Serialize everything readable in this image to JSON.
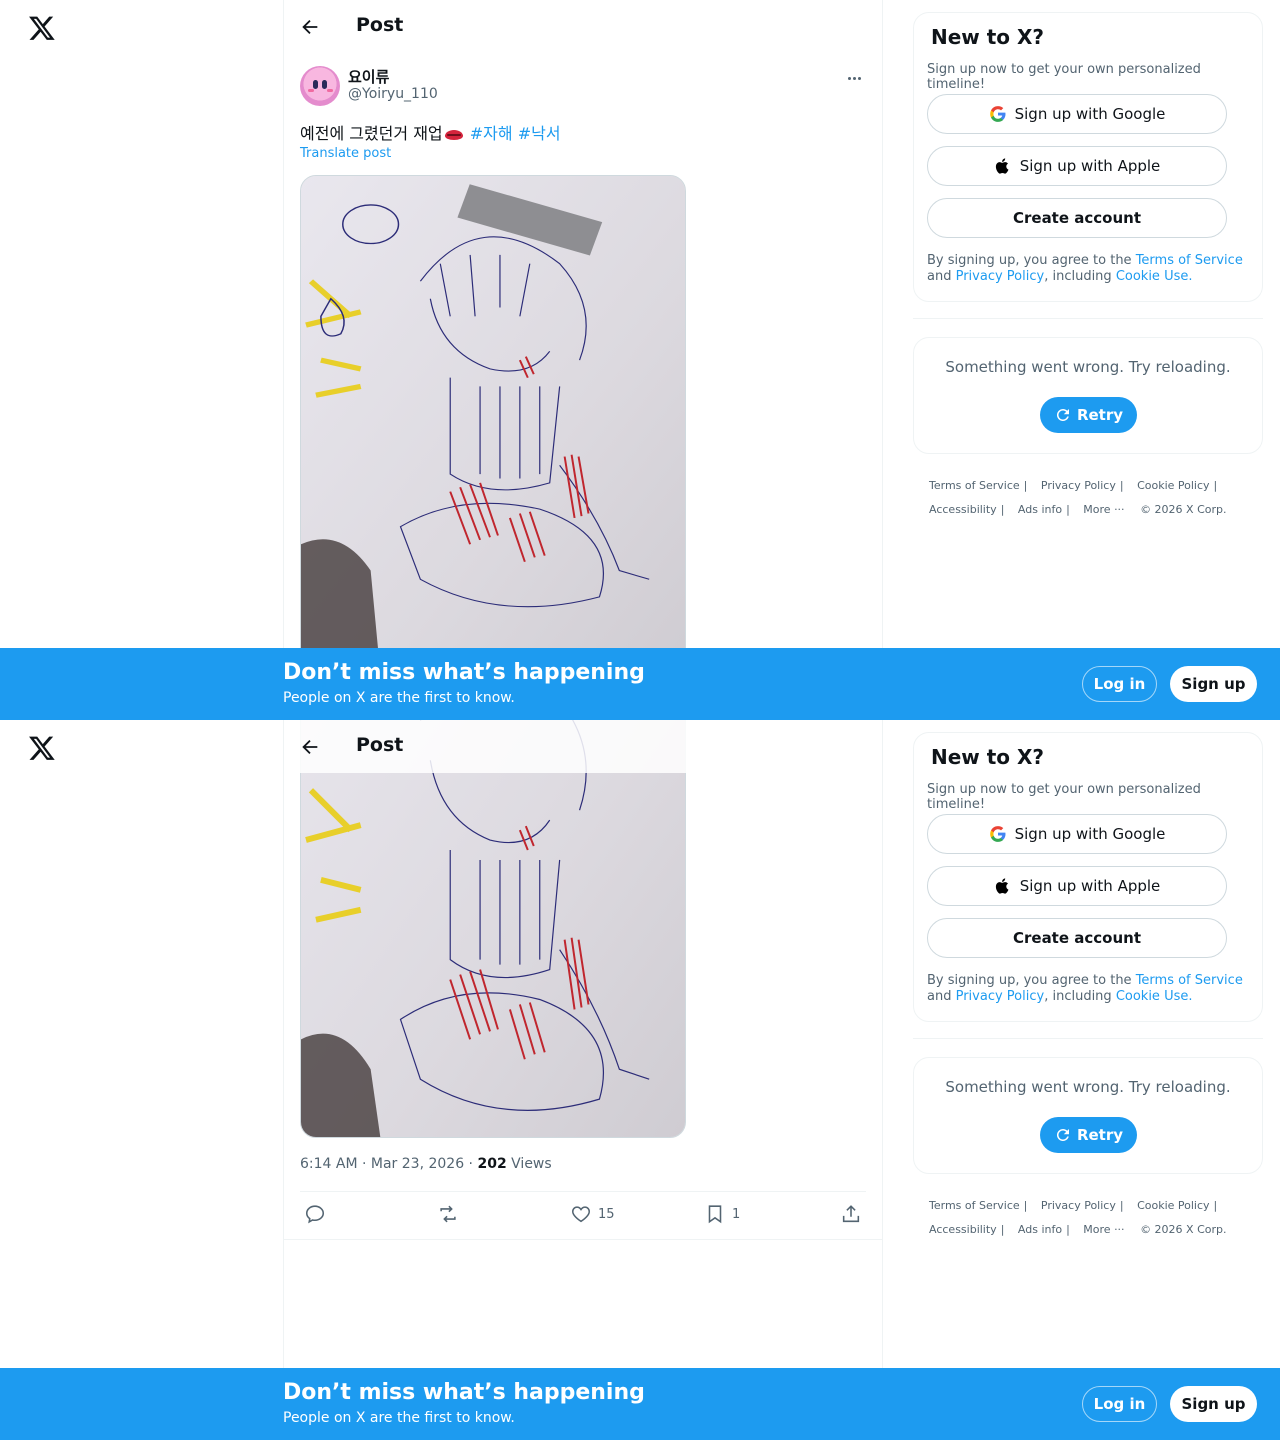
{
  "header": {
    "title": "Post"
  },
  "post": {
    "author_name": "요이류",
    "author_handle": "@Yoiryu_110",
    "text_main": "예전에 그렸던거 재업",
    "emoji_icon": "lips-emoji",
    "hashtags": [
      "#자해",
      "#낙서"
    ],
    "translate": "Translate post",
    "time": "6:14 AM · Mar 23, 2026 · ",
    "views_count": "202",
    "views_label": " Views",
    "image_description_icon": "sketch-image"
  },
  "actions": {
    "reply_count": "",
    "repost_count": "",
    "like_count": "15",
    "bookmark_count": "1"
  },
  "signup": {
    "title": "New to X?",
    "subtitle": "Sign up now to get your own personalized timeline!",
    "google": "Sign up with Google",
    "apple": "Sign up with Apple",
    "create": "Create account",
    "legal_prefix": "By signing up, you agree to the ",
    "terms": "Terms of Service",
    "and": " and ",
    "privacy": "Privacy Policy",
    "including": ", including ",
    "cookie": "Cookie Use."
  },
  "error": {
    "message": "Something went wrong. Try reloading.",
    "retry": "Retry"
  },
  "footer": {
    "links": [
      "Terms of Service",
      "Privacy Policy",
      "Cookie Policy",
      "Accessibility",
      "Ads info",
      "More ···",
      "© 2026 X Corp."
    ]
  },
  "banner": {
    "title": "Don’t miss what’s happening",
    "subtitle": "People on X are the first to know.",
    "login": "Log in",
    "signup": "Sign up"
  },
  "colors": {
    "accent": "#1d9bf0",
    "text": "#0f1419",
    "muted": "#536471"
  }
}
